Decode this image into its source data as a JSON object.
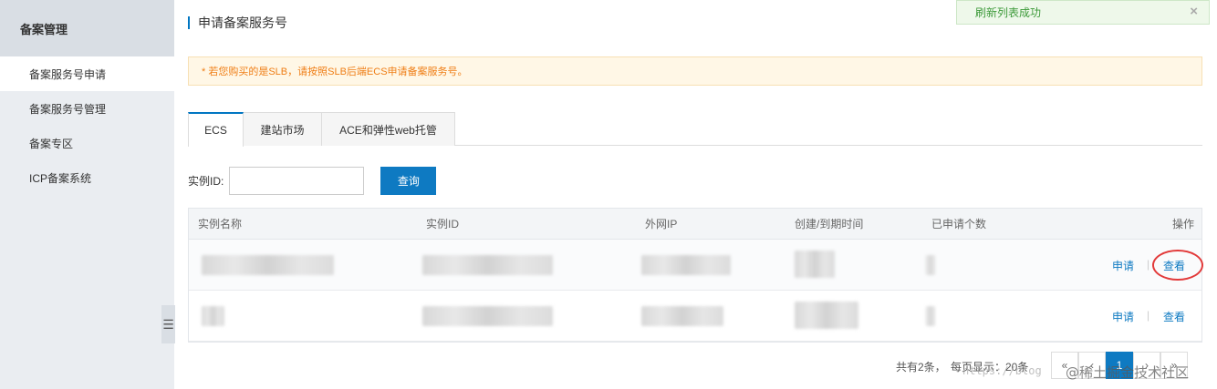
{
  "sidebar": {
    "title": "备案管理",
    "items": [
      {
        "label": "备案服务号申请"
      },
      {
        "label": "备案服务号管理"
      },
      {
        "label": "备案专区"
      },
      {
        "label": "ICP备案系统"
      }
    ],
    "collapse_icon": "☰"
  },
  "page": {
    "title": "申请备案服务号"
  },
  "toast": {
    "message": "刷新列表成功",
    "close": "×"
  },
  "warning": {
    "text": "* 若您购买的是SLB，请按照SLB后端ECS申请备案服务号。"
  },
  "tabs": [
    {
      "label": "ECS"
    },
    {
      "label": "建站市场"
    },
    {
      "label": "ACE和弹性web托管"
    }
  ],
  "search": {
    "label": "实例ID:",
    "value": "",
    "button": "查询"
  },
  "table": {
    "headers": [
      "实例名称",
      "实例ID",
      "外网IP",
      "创建/到期时间",
      "已申请个数",
      "操作"
    ],
    "rows": [
      {
        "apply": "申请",
        "separator": "|",
        "view": "查看"
      },
      {
        "apply": "申请",
        "separator": "|",
        "view": "查看"
      }
    ]
  },
  "pager": {
    "summary": "共有2条，",
    "page_size": "每页显示：20条",
    "prev_first": "«",
    "prev": "‹",
    "current": "1",
    "next": "›",
    "last": "»"
  },
  "watermark": {
    "url": "https://blog",
    "text": "@稀土掘金技术社区"
  },
  "colors": {
    "accent": "#0e7ac2",
    "warning": "#ef7e16",
    "success": "#3d9a3a",
    "highlight": "#e23a3a"
  }
}
